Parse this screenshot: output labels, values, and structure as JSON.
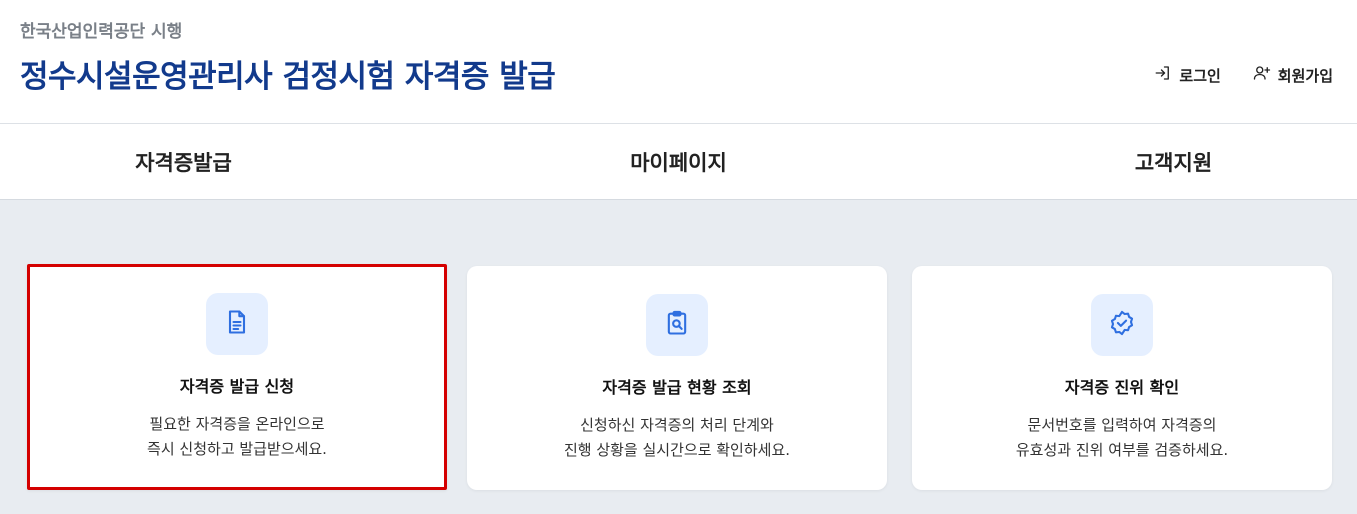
{
  "header": {
    "org": "한국산업인력공단 시행",
    "title": "정수시설운영관리사 검정시험 자격증 발급",
    "login_label": "로그인",
    "signup_label": "회원가입"
  },
  "nav": {
    "items": [
      "자격증발급",
      "마이페이지",
      "고객지원"
    ]
  },
  "cards": [
    {
      "title": "자격증 발급 신청",
      "desc_line1": "필요한 자격증을 온라인으로",
      "desc_line2": "즉시 신청하고 발급받으세요.",
      "icon": "document-icon"
    },
    {
      "title": "자격증 발급 현황 조회",
      "desc_line1": "신청하신 자격증의 처리 단계와",
      "desc_line2": "진행 상황을 실시간으로 확인하세요.",
      "icon": "clipboard-search-icon"
    },
    {
      "title": "자격증 진위 확인",
      "desc_line1": "문서번호를 입력하여 자격증의",
      "desc_line2": "유효성과 진위 여부를 검증하세요.",
      "icon": "verified-badge-icon"
    }
  ],
  "colors": {
    "title": "#123a8c",
    "accent": "#2f6fe0",
    "icon_bg": "#e5efff",
    "highlight": "#d40000"
  }
}
